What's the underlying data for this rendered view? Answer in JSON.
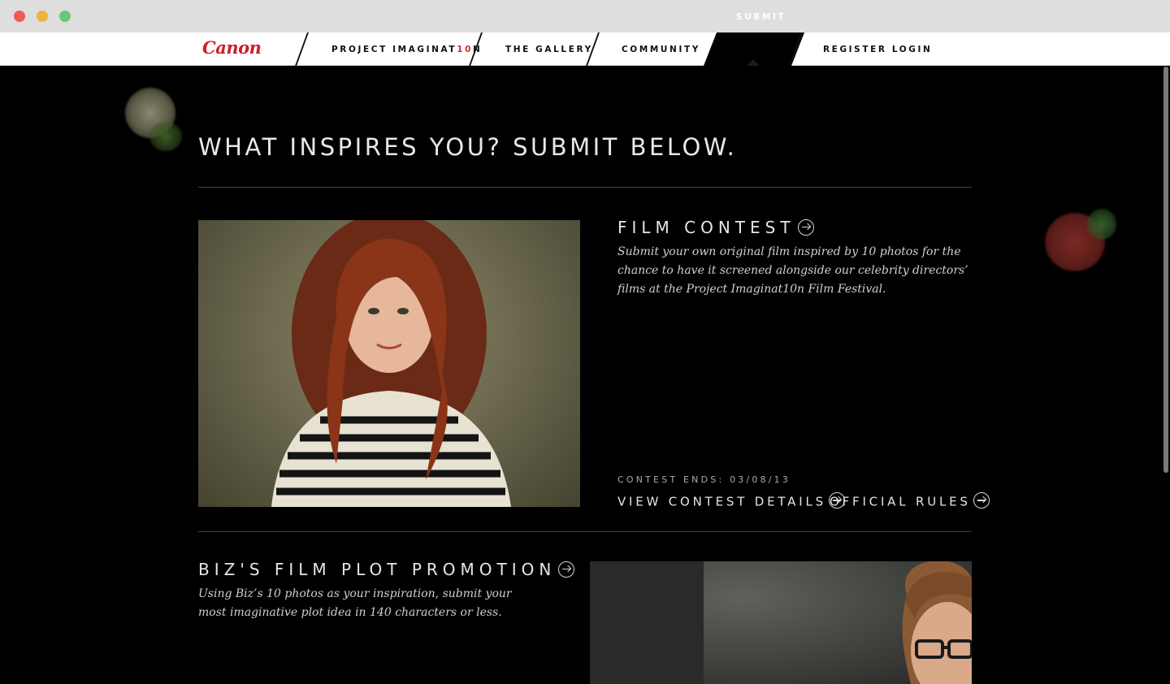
{
  "nav": {
    "logo": "Canon",
    "project_prefix": "PROJECT IMAGINAT",
    "project_highlight": "10",
    "project_suffix": "N",
    "gallery": "THE GALLERY",
    "community": "COMMUNITY",
    "submit": "SUBMIT",
    "register_login": "REGISTER LOGIN"
  },
  "page": {
    "title": "WHAT INSPIRES YOU? SUBMIT BELOW."
  },
  "film_contest": {
    "title": "FILM CONTEST",
    "description": "Submit your own original film inspired by 10 photos for the chance to have it screened alongside our celebrity directors’ films at the Project Imaginat10n Film Festival.",
    "ends": "CONTEST ENDS: 03/08/13",
    "details_link": "VIEW CONTEST DETAILS",
    "rules_link": "OFFICIAL RULES"
  },
  "biz_promo": {
    "title": "BIZ'S FILM PLOT PROMOTION",
    "description": "Using Biz’s 10 photos as your inspiration, submit your most imaginative plot idea in 140 characters or less."
  },
  "colors": {
    "brand_red": "#cc1f2a",
    "background": "#000000",
    "nav_background": "#ffffff"
  }
}
